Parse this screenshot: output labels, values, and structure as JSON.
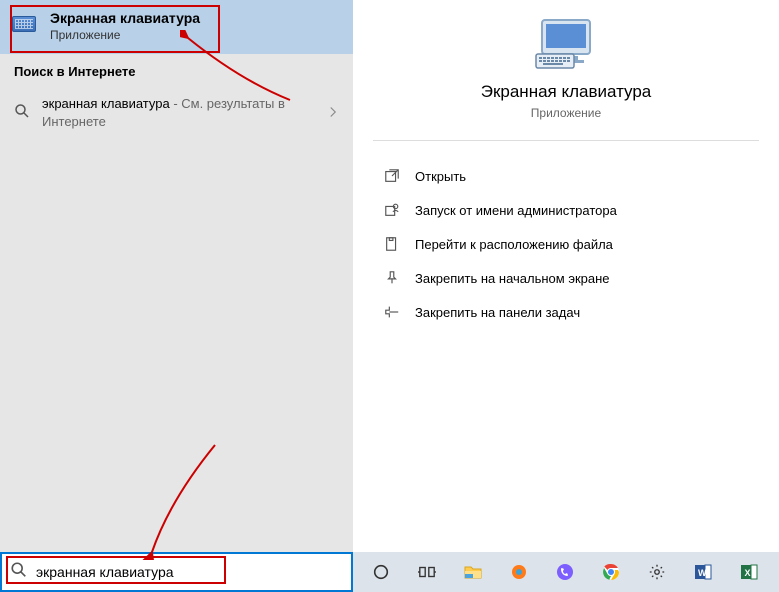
{
  "bestMatch": {
    "title": "Экранная клавиатура",
    "subtitle": "Приложение"
  },
  "webSection": {
    "header": "Поиск в Интернете",
    "query": "экранная клавиатура",
    "suffix": " - См. результаты в Интернете"
  },
  "details": {
    "title": "Экранная клавиатура",
    "subtitle": "Приложение"
  },
  "actions": {
    "open": "Открыть",
    "runAsAdmin": "Запуск от имени администратора",
    "fileLocation": "Перейти к расположению файла",
    "pinStart": "Закрепить на начальном экране",
    "pinTaskbar": "Закрепить на панели задач"
  },
  "searchInput": {
    "value": "экранная клавиатура"
  }
}
